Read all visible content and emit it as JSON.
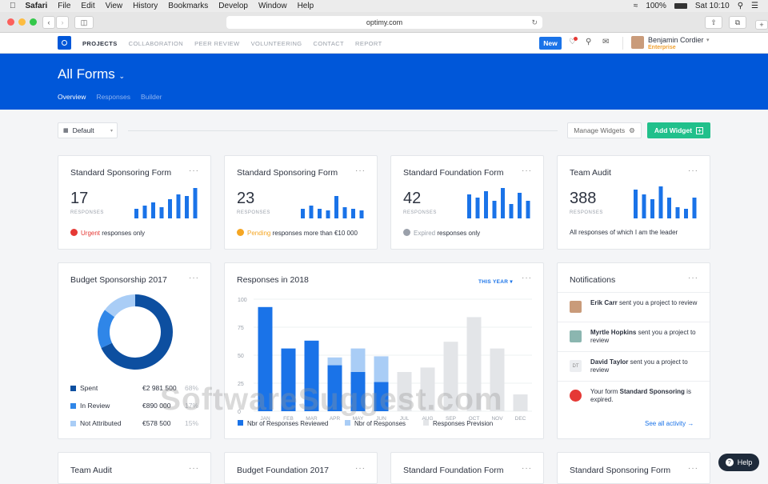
{
  "menubar": {
    "app": "Safari",
    "items": [
      "File",
      "Edit",
      "View",
      "History",
      "Bookmarks",
      "Develop",
      "Window",
      "Help"
    ],
    "battery": "100%",
    "clock": "Sat 10:10"
  },
  "browser": {
    "url": "optimy.com"
  },
  "topnav": {
    "items": [
      "PROJECTS",
      "COLLABORATION",
      "PEER REVIEW",
      "VOLUNTEERING",
      "CONTACT",
      "REPORT"
    ],
    "new_label": "New",
    "user_name": "Benjamin Cordier",
    "user_plan": "Enterprise"
  },
  "hero": {
    "title": "All Forms",
    "tabs": [
      "Overview",
      "Responses",
      "Builder"
    ]
  },
  "toolbar": {
    "view_label": "Default",
    "manage_label": "Manage Widgets",
    "add_label": "Add Widget"
  },
  "stat_cards": [
    {
      "title": "Standard Sponsoring Form",
      "count": "17",
      "unit": "RESPONSES",
      "status_word": "Urgent",
      "status_rest": "responses only",
      "status_color": "#e53935",
      "bars": [
        0.3,
        0.4,
        0.5,
        0.35,
        0.6,
        0.75,
        0.7,
        0.95
      ]
    },
    {
      "title": "Standard Sponsoring Form",
      "count": "23",
      "unit": "RESPONSES",
      "status_word": "Pending",
      "status_rest": "responses more than €10 000",
      "status_color": "#f5a623",
      "bars": [
        0.3,
        0.4,
        0.3,
        0.25,
        0.7,
        0.35,
        0.3,
        0.25
      ]
    },
    {
      "title": "Standard Foundation Form",
      "count": "42",
      "unit": "RESPONSES",
      "status_word": "Expired",
      "status_rest": "responses only",
      "status_color": "#9aa0aa",
      "bars": [
        0.75,
        0.65,
        0.85,
        0.55,
        0.95,
        0.45,
        0.8,
        0.55
      ]
    },
    {
      "title": "Team Audit",
      "count": "388",
      "unit": "RESPONSES",
      "status_word": "",
      "status_rest": "All responses of which I am the leader",
      "status_color": "#2d3340",
      "bars": [
        0.9,
        0.75,
        0.6,
        1.0,
        0.65,
        0.35,
        0.3,
        0.65
      ]
    }
  ],
  "budget": {
    "title": "Budget Sponsorship 2017",
    "legend": [
      {
        "label": "Spent",
        "value": "€2 981 500",
        "pct": "68%",
        "color": "#0d4fa0"
      },
      {
        "label": "In Review",
        "value": "€890 000",
        "pct": "17%",
        "color": "#2f86e8"
      },
      {
        "label": "Not Attributed",
        "value": "€578 500",
        "pct": "15%",
        "color": "#a9cdf6"
      }
    ]
  },
  "chart_data": {
    "type": "bar",
    "title": "Responses in 2018",
    "filter": "THIS YEAR",
    "ylim": [
      0,
      100
    ],
    "yticks": [
      "100",
      "75",
      "50",
      "25",
      "0"
    ],
    "categories": [
      "JAN",
      "FEB",
      "MAR",
      "APR",
      "MAY",
      "JUN",
      "JUL",
      "AUG",
      "SEP",
      "OCT",
      "NOV",
      "DEC"
    ],
    "series": [
      {
        "name": "Nbr of Responses Reviewed",
        "color": "#1a73e8",
        "values": [
          93,
          56,
          63,
          41,
          35,
          26,
          0,
          0,
          0,
          0,
          0,
          0
        ]
      },
      {
        "name": "Nbr of Responses",
        "color": "#a9cdf6",
        "values": [
          0,
          0,
          0,
          48,
          56,
          49,
          0,
          0,
          0,
          0,
          0,
          0
        ]
      },
      {
        "name": "Responses Prevision",
        "color": "#e3e5e8",
        "values": [
          0,
          0,
          0,
          0,
          0,
          0,
          35,
          39,
          62,
          84,
          56,
          15
        ]
      }
    ]
  },
  "notifications": {
    "title": "Notifications",
    "items": [
      {
        "pre": "",
        "bold": "Erik Carr",
        "post": " sent you a project to review",
        "avatar": "#c99b7a"
      },
      {
        "pre": "",
        "bold": "Myrtle Hopkins",
        "post": " sent you a project to review",
        "avatar": "#8bb6b0"
      },
      {
        "pre": "",
        "bold": "David Taylor",
        "post": " sent you a project to review",
        "avatar": "#eceef1",
        "initials": "DT"
      },
      {
        "pre": "Your form ",
        "bold": "Standard Sponsoring",
        "post": " is expired.",
        "avatar": "#e53935"
      }
    ],
    "see_all": "See all activity →"
  },
  "bottom_cards": [
    "Team Audit",
    "Budget Foundation 2017",
    "Standard Foundation Form",
    "Standard Sponsoring Form"
  ],
  "help_label": "Help",
  "watermark": "SoftwareSuggest.com"
}
